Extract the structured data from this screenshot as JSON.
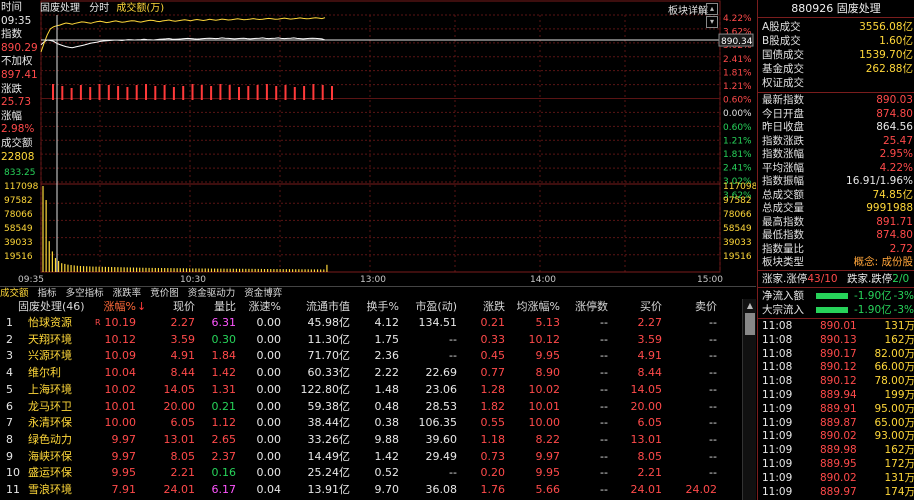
{
  "chart_header": {
    "time_label": "时间",
    "time_value": "09:35",
    "index_label": "指数",
    "index_value": "890.29",
    "unweighted_label": "不加权",
    "unweighted_value": "897.41",
    "change_label": "涨跌",
    "change_value": "25.73",
    "pct_label": "涨幅",
    "pct_value": "2.98%",
    "amount_label": "成交额",
    "amount_value": "22808",
    "tab_sector": "固废处理",
    "tab_timeshare": "分时",
    "tab_amount": "成交额(万)",
    "detail_link": "板块详解",
    "cursor_price": "890.34"
  },
  "chart_data": {
    "type": "line",
    "title": "固废处理 分时",
    "x_ticks": [
      "09:35",
      "10:30",
      "13:00",
      "14:00",
      "15:00"
    ],
    "price_axis_left": [
      "",
      "",
      "",
      "",
      "",
      "",
      "",
      "",
      "",
      "",
      "",
      "",
      ""
    ],
    "pct_axis": [
      "4.22%",
      "3.62%",
      "3.02%",
      "2.41%",
      "1.81%",
      "1.21%",
      "0.60%",
      "0.00%",
      "0.60%",
      "1.21%",
      "1.81%",
      "2.41%",
      "3.02%",
      "3.62%"
    ],
    "volume_axis": [
      "833.25",
      "117098",
      "97582",
      "78066",
      "58549",
      "39033",
      "19516"
    ],
    "prev_close": 864.56,
    "series": [
      {
        "name": "指数",
        "values": [
          888.3,
          889.5,
          890.3,
          890.1,
          889.8,
          888.9,
          888.4,
          887.9,
          887.5,
          887.2,
          887.0,
          887.3,
          887.6,
          887.9,
          888.2,
          888.6,
          889.0,
          889.2,
          889.4,
          889.7,
          889.9,
          890.0,
          890.1,
          890.2,
          890.3,
          890.2,
          890.1,
          890.3,
          890.5,
          890.4,
          890.3,
          890.4,
          890.5,
          890.6,
          890.5,
          890.4,
          890.3,
          890.5,
          890.6,
          890.7,
          890.8,
          890.9,
          890.7,
          890.6,
          890.7,
          890.8,
          890.9,
          891.0,
          890.9,
          890.8,
          890.7,
          890.8,
          890.9,
          891.0,
          891.1,
          891.0,
          890.9,
          891.0,
          891.2,
          891.1,
          891.0,
          890.9,
          890.8,
          890.9,
          891.0,
          891.1,
          890.9,
          890.8,
          890.9,
          891.0,
          891.1,
          891.2,
          891.0,
          890.9,
          891.0,
          891.1,
          891.2,
          891.0,
          890.9,
          891.0,
          891.1,
          891.2,
          891.0,
          890.9,
          890.8,
          890.9,
          891.0,
          891.1,
          891.0,
          890.9,
          890.8,
          890.3
        ]
      },
      {
        "name": "不加权",
        "values": [
          885.2,
          889.0,
          892.5,
          895.1,
          896.0,
          896.4,
          896.7,
          897.2,
          897.6,
          897.4,
          897.1,
          897.5,
          897.8,
          898.1,
          898.0,
          897.7,
          897.5,
          897.9,
          898.2,
          898.4,
          898.1,
          897.8,
          898.0,
          898.3,
          898.5,
          898.2,
          897.9,
          898.1,
          898.4,
          898.6,
          898.5,
          898.2,
          898.0,
          898.3,
          898.6,
          898.8,
          898.7,
          898.4,
          898.2,
          898.5,
          898.7,
          898.9,
          898.6,
          898.4,
          898.6,
          898.8,
          899.0,
          898.8,
          898.6,
          898.9,
          899.1,
          898.9,
          898.7,
          898.9,
          899.2,
          899.0,
          898.8,
          899.0,
          899.3,
          899.1,
          898.9,
          899.0,
          899.2,
          899.4,
          899.2,
          899.0,
          899.1,
          899.3,
          899.5,
          899.3,
          899.1,
          899.2,
          899.4,
          899.6,
          899.4,
          899.2,
          899.3,
          899.5,
          899.7,
          899.5,
          899.3,
          899.4,
          899.6,
          899.8,
          899.6,
          899.4,
          899.5,
          899.7,
          899.9,
          899.7,
          899.5,
          899.9
        ]
      }
    ],
    "updown": [
      16,
      14,
      12,
      15,
      13,
      16,
      15,
      14,
      13,
      15,
      16,
      14,
      15,
      13,
      14,
      16,
      15,
      14,
      16,
      15,
      13,
      14,
      15,
      16,
      14,
      15,
      13,
      14,
      16,
      15,
      14
    ],
    "volume": [
      117098,
      98000,
      42000,
      28000,
      19000,
      15000,
      12000,
      11000,
      10000,
      9500,
      9000,
      8500,
      8200,
      8000,
      7800,
      7600,
      7400,
      7300,
      7200,
      7100,
      7000,
      6900,
      6800,
      6700,
      6600,
      6500,
      6400,
      6300,
      6200,
      6100,
      6000,
      5900,
      5800,
      5700,
      5600,
      5600,
      5500,
      5500,
      5400,
      5400,
      5300,
      5300,
      5200,
      5200,
      5100,
      5100,
      5000,
      5000,
      4900,
      4900,
      4800,
      4800,
      4800,
      4700,
      4700,
      4700,
      4600,
      4600,
      4600,
      4500,
      4500,
      4500,
      4400,
      4400,
      4400,
      4300,
      4300,
      4300,
      4200,
      4200,
      4200,
      4100,
      4100,
      4100,
      4000,
      4000,
      4000,
      3900,
      3900,
      3900,
      3800,
      3800,
      3800,
      3700,
      3700,
      3700,
      3600,
      3600,
      3600,
      3500,
      3500,
      9800
    ]
  },
  "bottom_tabs": [
    "成交额",
    "指标",
    "多空指标",
    "涨跌率",
    "竞价图",
    "资金驱动力",
    "资金博弈"
  ],
  "table": {
    "columns": [
      "固废处理(46)",
      "涨幅%",
      "现价",
      "量比",
      "涨速%",
      "流通市值",
      "换手%",
      "市盈(动)",
      "涨跌",
      "均涨幅%",
      "涨停数",
      "买价",
      "卖价"
    ],
    "rows": [
      [
        "1",
        "怡球资源",
        "R",
        "10.19",
        "2.27",
        "6.31",
        "0.00",
        "45.98亿",
        "4.12",
        "134.51",
        "0.21",
        "5.13",
        "--",
        "2.27",
        "--"
      ],
      [
        "2",
        "天翔环境",
        "",
        "10.12",
        "3.59",
        "0.30",
        "0.00",
        "11.30亿",
        "1.75",
        "--",
        "0.33",
        "10.12",
        "--",
        "3.59",
        "--"
      ],
      [
        "3",
        "兴源环境",
        "",
        "10.09",
        "4.91",
        "1.84",
        "0.00",
        "71.70亿",
        "2.36",
        "--",
        "0.45",
        "9.95",
        "--",
        "4.91",
        "--"
      ],
      [
        "4",
        "维尔利",
        "",
        "10.04",
        "8.44",
        "1.42",
        "0.00",
        "60.33亿",
        "2.22",
        "22.69",
        "0.77",
        "8.90",
        "--",
        "8.44",
        "--"
      ],
      [
        "5",
        "上海环境",
        "",
        "10.02",
        "14.05",
        "1.31",
        "0.00",
        "122.80亿",
        "1.48",
        "23.06",
        "1.28",
        "10.02",
        "--",
        "14.05",
        "--"
      ],
      [
        "6",
        "龙马环卫",
        "",
        "10.01",
        "20.00",
        "0.21",
        "0.00",
        "59.38亿",
        "0.48",
        "28.53",
        "1.82",
        "10.01",
        "--",
        "20.00",
        "--"
      ],
      [
        "7",
        "永清环保",
        "",
        "10.00",
        "6.05",
        "1.12",
        "0.00",
        "38.44亿",
        "0.38",
        "106.35",
        "0.55",
        "10.00",
        "--",
        "6.05",
        "--"
      ],
      [
        "8",
        "绿色动力",
        "",
        "9.97",
        "13.01",
        "2.65",
        "0.00",
        "33.26亿",
        "9.88",
        "39.60",
        "1.18",
        "8.22",
        "--",
        "13.01",
        "--"
      ],
      [
        "9",
        "海峡环保",
        "",
        "9.97",
        "8.05",
        "2.37",
        "0.00",
        "14.49亿",
        "1.42",
        "29.49",
        "0.73",
        "9.97",
        "--",
        "8.05",
        "--"
      ],
      [
        "10",
        "盛运环保",
        "",
        "9.95",
        "2.21",
        "0.16",
        "0.00",
        "25.24亿",
        "0.52",
        "--",
        "0.20",
        "9.95",
        "--",
        "2.21",
        "--"
      ],
      [
        "11",
        "雪浪环境",
        "",
        "7.91",
        "24.01",
        "6.17",
        "0.04",
        "13.91亿",
        "9.70",
        "36.08",
        "1.76",
        "5.66",
        "--",
        "24.01",
        "24.02"
      ]
    ]
  },
  "right_panel": {
    "title": "880926 固废处理",
    "top": [
      {
        "k": "A股成交",
        "v": "3556.08亿"
      },
      {
        "k": "B股成交",
        "v": "1.60亿"
      },
      {
        "k": "国债成交",
        "v": "1539.70亿"
      },
      {
        "k": "基金成交",
        "v": "262.88亿"
      },
      {
        "k": "权证成交",
        "v": ""
      }
    ],
    "stats": [
      {
        "k": "最新指数",
        "v": "890.03",
        "c": "red"
      },
      {
        "k": "今日开盘",
        "v": "874.80",
        "c": "red"
      },
      {
        "k": "昨日收盘",
        "v": "864.56",
        "c": "wht"
      },
      {
        "k": "指数涨跌",
        "v": "25.47",
        "c": "red"
      },
      {
        "k": "指数涨幅",
        "v": "2.95%",
        "c": "red"
      },
      {
        "k": "平均涨幅",
        "v": "4.22%",
        "c": "red"
      },
      {
        "k": "指数振幅",
        "v": "16.91/1.96%",
        "c": "wht"
      },
      {
        "k": "总成交额",
        "v": "74.85亿",
        "c": "yel"
      },
      {
        "k": "总成交量",
        "v": "9991988",
        "c": "yel"
      },
      {
        "k": "最高指数",
        "v": "891.71",
        "c": "red"
      },
      {
        "k": "最低指数",
        "v": "874.80",
        "c": "red"
      },
      {
        "k": "指数量比",
        "v": "2.72",
        "c": "red"
      }
    ],
    "type_label": "板块类型",
    "type_value": "概念: 成份股",
    "updown_text1": "涨家.涨停",
    "updown_val1": "43/10",
    "updown_text2": "跌家.跌停",
    "updown_val2": "2/0",
    "flow_in_label": "净流入额",
    "flow_in_amt": "-1.90亿",
    "flow_in_pct": "-3%",
    "flow_big_label": "大宗流入",
    "flow_big_amt": "-1.90亿",
    "flow_big_pct": "-3%",
    "ticks": [
      [
        "11:08",
        "890.01",
        "131万"
      ],
      [
        "11:08",
        "890.13",
        "162万"
      ],
      [
        "11:08",
        "890.17",
        "82.00万"
      ],
      [
        "11:08",
        "890.12",
        "66.00万"
      ],
      [
        "11:08",
        "890.12",
        "78.00万"
      ],
      [
        "11:09",
        "889.94",
        "199万"
      ],
      [
        "11:09",
        "889.91",
        "95.00万"
      ],
      [
        "11:09",
        "889.87",
        "65.00万"
      ],
      [
        "11:09",
        "890.02",
        "93.00万"
      ],
      [
        "11:09",
        "889.98",
        "162万"
      ],
      [
        "11:09",
        "889.95",
        "172万"
      ],
      [
        "11:09",
        "890.02",
        "131万"
      ],
      [
        "11:09",
        "889.97",
        "174万"
      ]
    ]
  }
}
